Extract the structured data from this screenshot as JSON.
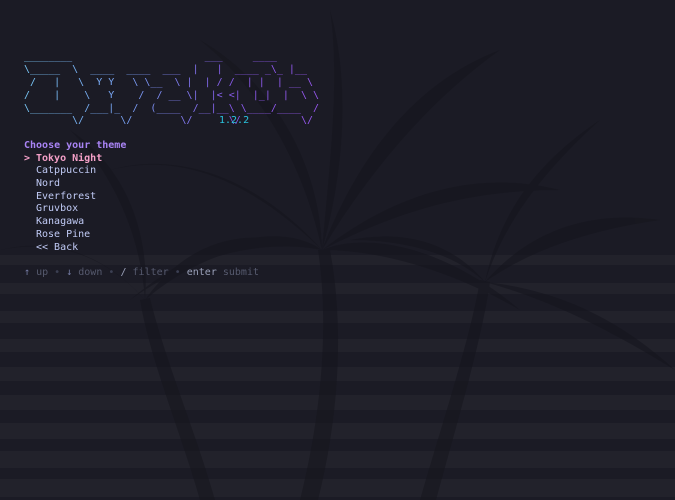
{
  "logo_art": [
    "________                      ___     ____",
    "\\_____  \\  ____  ____  ___  |   |  ____ _\\_ |__",
    " /   |   \\  Y Y   \\ \\__  \\ |  | / /  | |  | __ \\",
    "/    |    \\   Y    /  / __ \\|  |< <|  |_|  |  \\ \\",
    "\\_______  /___|_  /  (____  /__|__\\ \\____/____  /",
    "        \\/      \\/        \\/      \\/          \\/"
  ],
  "version": "1.2.2",
  "prompt": {
    "title": "Choose your theme",
    "cursor": ">",
    "selected_index": 0,
    "options": [
      "Tokyo Night",
      "Catppuccin",
      "Nord",
      "Everforest",
      "Gruvbox",
      "Kanagawa",
      "Rose Pine",
      "<< Back"
    ]
  },
  "help": {
    "up_key": "↑",
    "up_label": "up",
    "down_key": "↓",
    "down_label": "down",
    "filter_key": "/",
    "filter_label": "filter",
    "submit_key": "enter",
    "submit_label": "submit",
    "separator": "•"
  },
  "colors": {
    "background": "#1b1b25",
    "accent_purple": "#a984f5",
    "selected_pink": "#f5a0c8",
    "version_cyan": "#2ac3de",
    "text": "#c0caf5",
    "muted": "#565a6e"
  }
}
